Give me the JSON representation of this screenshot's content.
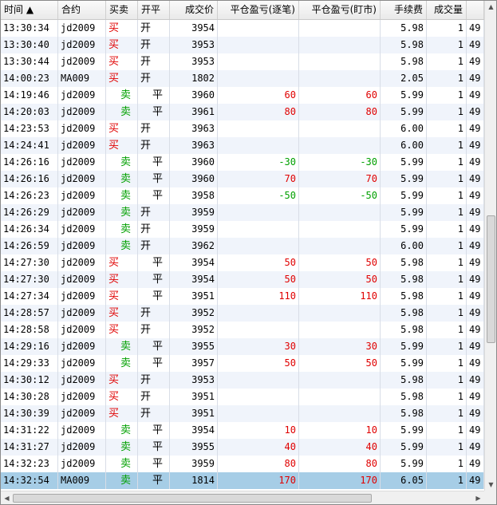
{
  "columns": [
    {
      "key": "time",
      "label": "时间 ▲"
    },
    {
      "key": "contract",
      "label": "合约"
    },
    {
      "key": "side",
      "label": "买卖"
    },
    {
      "key": "openclose",
      "label": "开平"
    },
    {
      "key": "price",
      "label": "成交价"
    },
    {
      "key": "pnl_trade",
      "label": "平仓盈亏(逐笔)"
    },
    {
      "key": "pnl_mark",
      "label": "平仓盈亏(盯市)"
    },
    {
      "key": "fee",
      "label": "手续费"
    },
    {
      "key": "qty",
      "label": "成交量"
    },
    {
      "key": "extra",
      "label": ""
    }
  ],
  "rows": [
    {
      "time": "13:30:34",
      "contract": "jd2009",
      "side": "买",
      "openclose": "开",
      "price": "3954",
      "pnl_trade": "",
      "pnl_mark": "",
      "fee": "5.98",
      "qty": "1",
      "extra": "49"
    },
    {
      "time": "13:30:40",
      "contract": "jd2009",
      "side": "买",
      "openclose": "开",
      "price": "3953",
      "pnl_trade": "",
      "pnl_mark": "",
      "fee": "5.98",
      "qty": "1",
      "extra": "49"
    },
    {
      "time": "13:30:44",
      "contract": "jd2009",
      "side": "买",
      "openclose": "开",
      "price": "3953",
      "pnl_trade": "",
      "pnl_mark": "",
      "fee": "5.98",
      "qty": "1",
      "extra": "49"
    },
    {
      "time": "14:00:23",
      "contract": "MA009",
      "side": "买",
      "openclose": "开",
      "price": "1802",
      "pnl_trade": "",
      "pnl_mark": "",
      "fee": "2.05",
      "qty": "1",
      "extra": "49"
    },
    {
      "time": "14:19:46",
      "contract": "jd2009",
      "side": "卖",
      "openclose": "平",
      "price": "3960",
      "pnl_trade": "60",
      "pnl_mark": "60",
      "fee": "5.99",
      "qty": "1",
      "extra": "49"
    },
    {
      "time": "14:20:03",
      "contract": "jd2009",
      "side": "卖",
      "openclose": "平",
      "price": "3961",
      "pnl_trade": "80",
      "pnl_mark": "80",
      "fee": "5.99",
      "qty": "1",
      "extra": "49"
    },
    {
      "time": "14:23:53",
      "contract": "jd2009",
      "side": "买",
      "openclose": "开",
      "price": "3963",
      "pnl_trade": "",
      "pnl_mark": "",
      "fee": "6.00",
      "qty": "1",
      "extra": "49"
    },
    {
      "time": "14:24:41",
      "contract": "jd2009",
      "side": "买",
      "openclose": "开",
      "price": "3963",
      "pnl_trade": "",
      "pnl_mark": "",
      "fee": "6.00",
      "qty": "1",
      "extra": "49"
    },
    {
      "time": "14:26:16",
      "contract": "jd2009",
      "side": "卖",
      "openclose": "平",
      "price": "3960",
      "pnl_trade": "-30",
      "pnl_mark": "-30",
      "fee": "5.99",
      "qty": "1",
      "extra": "49"
    },
    {
      "time": "14:26:16",
      "contract": "jd2009",
      "side": "卖",
      "openclose": "平",
      "price": "3960",
      "pnl_trade": "70",
      "pnl_mark": "70",
      "fee": "5.99",
      "qty": "1",
      "extra": "49"
    },
    {
      "time": "14:26:23",
      "contract": "jd2009",
      "side": "卖",
      "openclose": "平",
      "price": "3958",
      "pnl_trade": "-50",
      "pnl_mark": "-50",
      "fee": "5.99",
      "qty": "1",
      "extra": "49"
    },
    {
      "time": "14:26:29",
      "contract": "jd2009",
      "side": "卖",
      "openclose": "开",
      "price": "3959",
      "pnl_trade": "",
      "pnl_mark": "",
      "fee": "5.99",
      "qty": "1",
      "extra": "49"
    },
    {
      "time": "14:26:34",
      "contract": "jd2009",
      "side": "卖",
      "openclose": "开",
      "price": "3959",
      "pnl_trade": "",
      "pnl_mark": "",
      "fee": "5.99",
      "qty": "1",
      "extra": "49"
    },
    {
      "time": "14:26:59",
      "contract": "jd2009",
      "side": "卖",
      "openclose": "开",
      "price": "3962",
      "pnl_trade": "",
      "pnl_mark": "",
      "fee": "6.00",
      "qty": "1",
      "extra": "49"
    },
    {
      "time": "14:27:30",
      "contract": "jd2009",
      "side": "买",
      "openclose": "平",
      "price": "3954",
      "pnl_trade": "50",
      "pnl_mark": "50",
      "fee": "5.98",
      "qty": "1",
      "extra": "49"
    },
    {
      "time": "14:27:30",
      "contract": "jd2009",
      "side": "买",
      "openclose": "平",
      "price": "3954",
      "pnl_trade": "50",
      "pnl_mark": "50",
      "fee": "5.98",
      "qty": "1",
      "extra": "49"
    },
    {
      "time": "14:27:34",
      "contract": "jd2009",
      "side": "买",
      "openclose": "平",
      "price": "3951",
      "pnl_trade": "110",
      "pnl_mark": "110",
      "fee": "5.98",
      "qty": "1",
      "extra": "49"
    },
    {
      "time": "14:28:57",
      "contract": "jd2009",
      "side": "买",
      "openclose": "开",
      "price": "3952",
      "pnl_trade": "",
      "pnl_mark": "",
      "fee": "5.98",
      "qty": "1",
      "extra": "49"
    },
    {
      "time": "14:28:58",
      "contract": "jd2009",
      "side": "买",
      "openclose": "开",
      "price": "3952",
      "pnl_trade": "",
      "pnl_mark": "",
      "fee": "5.98",
      "qty": "1",
      "extra": "49"
    },
    {
      "time": "14:29:16",
      "contract": "jd2009",
      "side": "卖",
      "openclose": "平",
      "price": "3955",
      "pnl_trade": "30",
      "pnl_mark": "30",
      "fee": "5.99",
      "qty": "1",
      "extra": "49"
    },
    {
      "time": "14:29:33",
      "contract": "jd2009",
      "side": "卖",
      "openclose": "平",
      "price": "3957",
      "pnl_trade": "50",
      "pnl_mark": "50",
      "fee": "5.99",
      "qty": "1",
      "extra": "49"
    },
    {
      "time": "14:30:12",
      "contract": "jd2009",
      "side": "买",
      "openclose": "开",
      "price": "3953",
      "pnl_trade": "",
      "pnl_mark": "",
      "fee": "5.98",
      "qty": "1",
      "extra": "49"
    },
    {
      "time": "14:30:28",
      "contract": "jd2009",
      "side": "买",
      "openclose": "开",
      "price": "3951",
      "pnl_trade": "",
      "pnl_mark": "",
      "fee": "5.98",
      "qty": "1",
      "extra": "49"
    },
    {
      "time": "14:30:39",
      "contract": "jd2009",
      "side": "买",
      "openclose": "开",
      "price": "3951",
      "pnl_trade": "",
      "pnl_mark": "",
      "fee": "5.98",
      "qty": "1",
      "extra": "49"
    },
    {
      "time": "14:31:22",
      "contract": "jd2009",
      "side": "卖",
      "openclose": "平",
      "price": "3954",
      "pnl_trade": "10",
      "pnl_mark": "10",
      "fee": "5.99",
      "qty": "1",
      "extra": "49"
    },
    {
      "time": "14:31:27",
      "contract": "jd2009",
      "side": "卖",
      "openclose": "平",
      "price": "3955",
      "pnl_trade": "40",
      "pnl_mark": "40",
      "fee": "5.99",
      "qty": "1",
      "extra": "49"
    },
    {
      "time": "14:32:23",
      "contract": "jd2009",
      "side": "卖",
      "openclose": "平",
      "price": "3959",
      "pnl_trade": "80",
      "pnl_mark": "80",
      "fee": "5.99",
      "qty": "1",
      "extra": "49"
    },
    {
      "time": "14:32:54",
      "contract": "MA009",
      "side": "卖",
      "openclose": "平",
      "price": "1814",
      "pnl_trade": "170",
      "pnl_mark": "170",
      "fee": "6.05",
      "qty": "1",
      "extra": "49"
    }
  ],
  "selected_row": 27,
  "colors": {
    "buy": "#e00000",
    "sell": "#00a000",
    "profit": "#e00000",
    "loss": "#00a000",
    "selected": "#a6cde6"
  },
  "scroll": {
    "vertical_position": 0.6,
    "horizontal_position": 0.0
  }
}
